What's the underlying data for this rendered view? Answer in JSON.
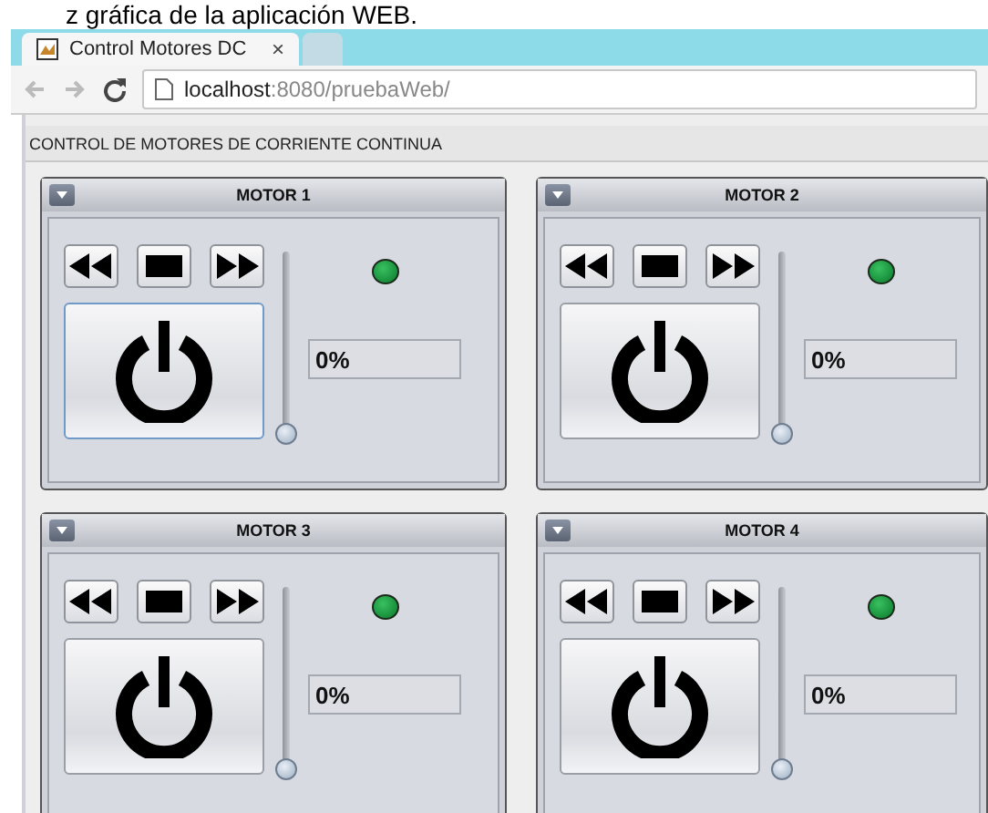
{
  "caption": "z gráfica de la aplicación WEB.",
  "browser": {
    "tabs": [
      {
        "title": "Control Motores DC",
        "close": "×",
        "selected": true
      },
      {
        "selected": false
      }
    ],
    "url_host": "localhost",
    "url_path": ":8080/pruebaWeb/"
  },
  "header": "CONTROL DE MOTORES DE CORRIENTE CONTINUA",
  "motors": [
    {
      "title": "MOTOR 1",
      "speed": "0%",
      "level": 0,
      "led_on": true,
      "power_focused": true
    },
    {
      "title": "MOTOR 2",
      "speed": "0%",
      "level": 0,
      "led_on": true,
      "power_focused": false
    },
    {
      "title": "MOTOR 3",
      "speed": "0%",
      "level": 0,
      "led_on": true,
      "power_focused": false
    },
    {
      "title": "MOTOR 4",
      "speed": "0%",
      "level": 0,
      "led_on": true,
      "power_focused": false
    }
  ]
}
